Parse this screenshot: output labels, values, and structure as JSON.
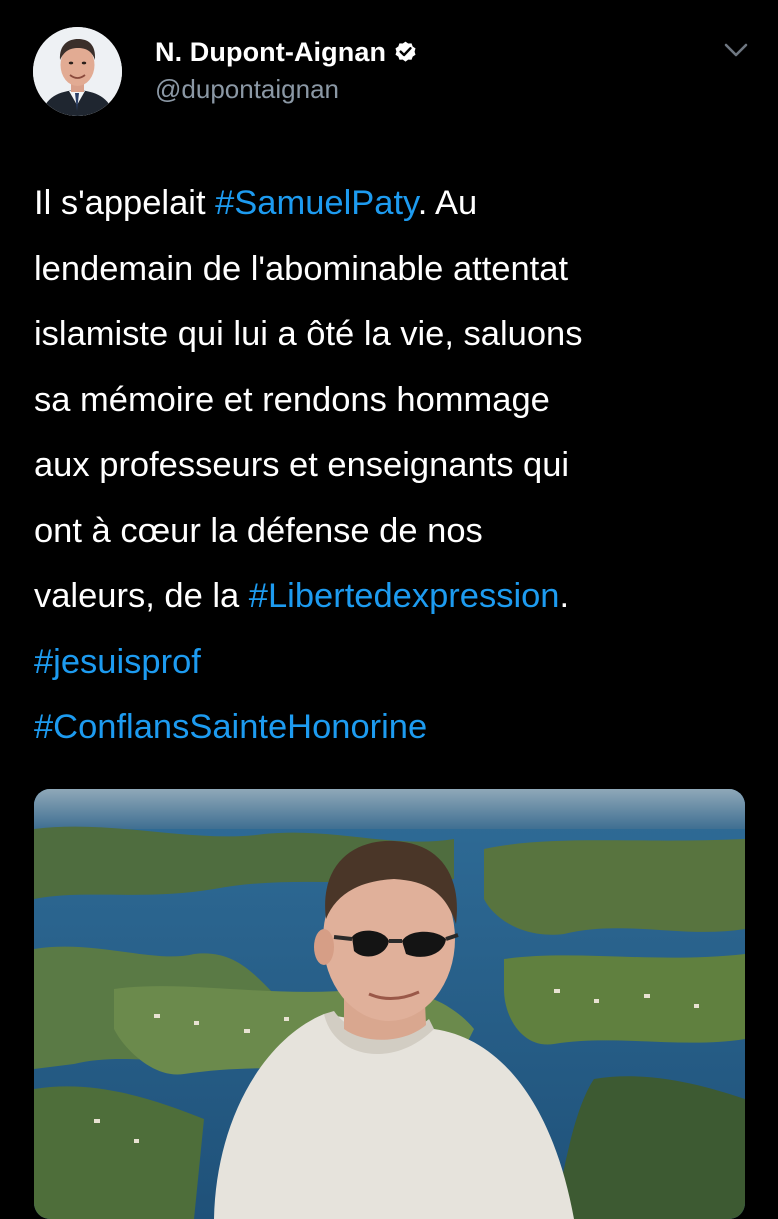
{
  "author": {
    "display_name": "N. Dupont-Aignan",
    "handle": "@dupontaignan",
    "verified": true,
    "avatar_icon": "profile-photo"
  },
  "more_icon": "chevron-down-icon",
  "tweet": {
    "lines": [
      [
        {
          "t": "Il s'appelait "
        },
        {
          "t": "#SamuelPaty",
          "tag": true
        },
        {
          "t": ". Au"
        }
      ],
      [
        {
          "t": "lendemain de l'abominable attentat"
        }
      ],
      [
        {
          "t": "islamiste qui lui a ôté la vie, saluons"
        }
      ],
      [
        {
          "t": "sa mémoire et rendons hommage"
        }
      ],
      [
        {
          "t": "aux professeurs et enseignants qui"
        }
      ],
      [
        {
          "t": "ont à cœur la défense de nos"
        }
      ],
      [
        {
          "t": "valeurs, de la "
        },
        {
          "t": "#Libertedexpression",
          "tag": true
        },
        {
          "t": "."
        }
      ],
      [
        {
          "t": "#jesuisprof",
          "tag": true
        }
      ],
      [
        {
          "t": "#ConflansSainteHonorine",
          "tag": true
        }
      ]
    ]
  },
  "colors": {
    "background": "#000000",
    "text": "#ffffff",
    "secondary": "#8b98a5",
    "link": "#1d9bf0",
    "verified_badge": "#ffffff"
  },
  "media": {
    "type": "photo",
    "icon": "photo-man-sunglasses-coastal-landscape"
  }
}
